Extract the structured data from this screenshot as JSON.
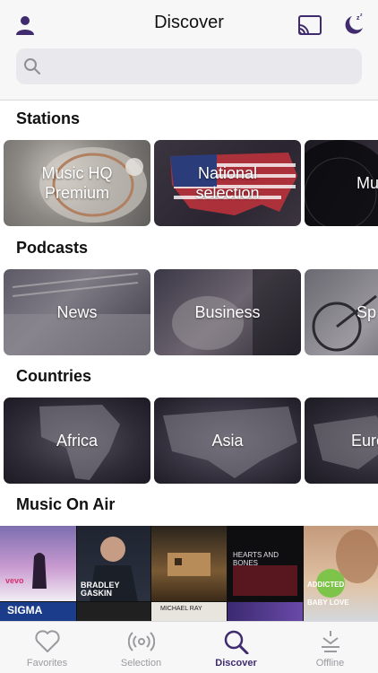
{
  "header": {
    "title": "Discover",
    "search_placeholder": ""
  },
  "colors": {
    "accent": "#3f2b6e",
    "tab_inactive": "#9a9a9f"
  },
  "sections": {
    "stations": {
      "title": "Stations",
      "cards": [
        {
          "label": "Music HQ\nPremium"
        },
        {
          "label": "National\nselection"
        },
        {
          "label": "Mu"
        }
      ]
    },
    "podcasts": {
      "title": "Podcasts",
      "cards": [
        {
          "label": "News"
        },
        {
          "label": "Business"
        },
        {
          "label": "Sp"
        }
      ]
    },
    "countries": {
      "title": "Countries",
      "cards": [
        {
          "label": "Africa"
        },
        {
          "label": "Asia"
        },
        {
          "label": "Euro"
        }
      ]
    },
    "music_on_air": {
      "title": "Music On Air",
      "album_texts": {
        "a1": "vevo",
        "a2": "BRADLEY\nGASKIN",
        "a3": "HEARTS AND BONES",
        "a4": "ADDICTED\nBABY LOVE",
        "a5": "SIGMA",
        "a6": "MICHAEL RAY"
      }
    }
  },
  "tabs": [
    {
      "label": "Favorites",
      "icon": "heart-icon"
    },
    {
      "label": "Selection",
      "icon": "radio-waves-icon"
    },
    {
      "label": "Discover",
      "icon": "search-icon"
    },
    {
      "label": "Offline",
      "icon": "download-icon"
    }
  ]
}
